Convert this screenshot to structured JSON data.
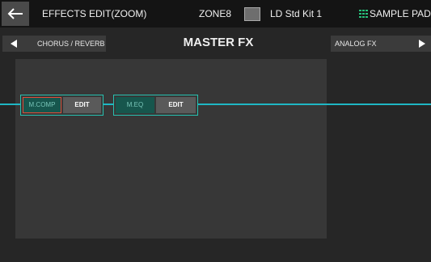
{
  "header": {
    "back_icon": "left-arrow-icon",
    "title": "EFFECTS EDIT(ZOOM)",
    "zone": "ZONE8",
    "kit_name": "LD Std Kit 1",
    "sample_pad_label": "SAMPLE PAD",
    "sample_pad_icon_color": "#27c07a"
  },
  "nav": {
    "prev_label": "CHORUS / REVERB",
    "next_label": "ANALOG FX",
    "page_title": "MASTER FX"
  },
  "chain": {
    "line_color": "#1fb7c4",
    "effects": [
      {
        "name": "M.COMP",
        "edit_label": "EDIT",
        "selected": true
      },
      {
        "name": "M.EQ",
        "edit_label": "EDIT",
        "selected": false
      }
    ]
  }
}
